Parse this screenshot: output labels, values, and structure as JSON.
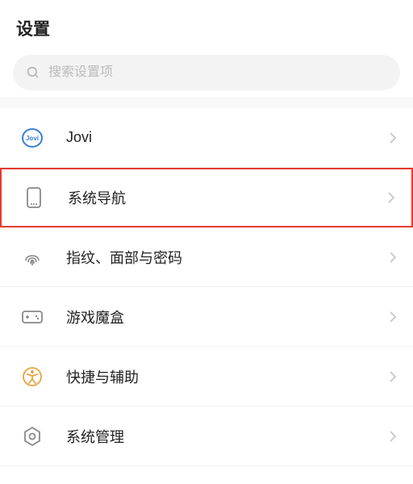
{
  "header": {
    "title": "设置"
  },
  "search": {
    "placeholder": "搜索设置项"
  },
  "items": [
    {
      "label": "Jovi",
      "highlighted": false
    },
    {
      "label": "系统导航",
      "highlighted": true
    },
    {
      "label": "指纹、面部与密码",
      "highlighted": false
    },
    {
      "label": "游戏魔盒",
      "highlighted": false
    },
    {
      "label": "快捷与辅助",
      "highlighted": false
    },
    {
      "label": "系统管理",
      "highlighted": false
    }
  ],
  "colors": {
    "highlight_border": "#e63a2e",
    "jovi_blue": "#3b7fd6",
    "accessibility_orange": "#e8a43f"
  }
}
